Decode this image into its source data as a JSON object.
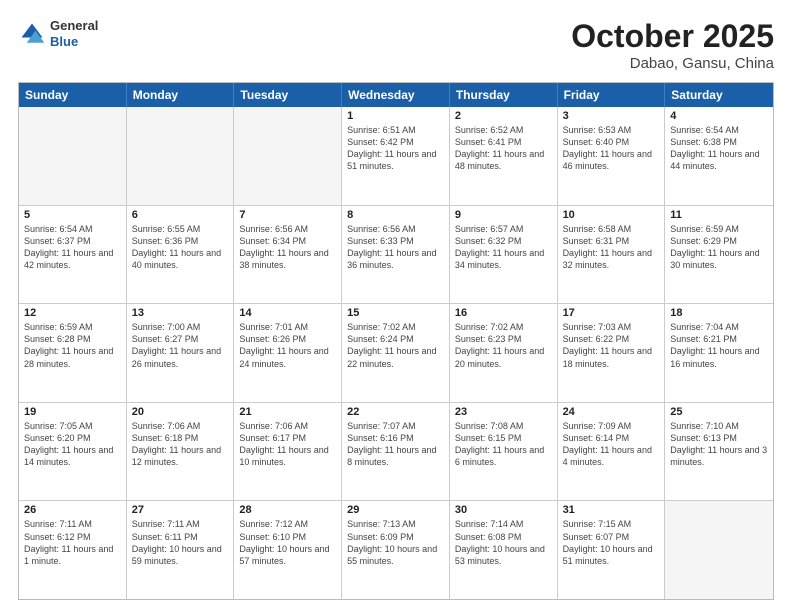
{
  "header": {
    "logo_general": "General",
    "logo_blue": "Blue",
    "title": "October 2025",
    "subtitle": "Dabao, Gansu, China"
  },
  "days": [
    "Sunday",
    "Monday",
    "Tuesday",
    "Wednesday",
    "Thursday",
    "Friday",
    "Saturday"
  ],
  "rows": [
    [
      {
        "date": "",
        "info": "",
        "empty": true
      },
      {
        "date": "",
        "info": "",
        "empty": true
      },
      {
        "date": "",
        "info": "",
        "empty": true
      },
      {
        "date": "1",
        "info": "Sunrise: 6:51 AM\nSunset: 6:42 PM\nDaylight: 11 hours\nand 51 minutes.",
        "empty": false
      },
      {
        "date": "2",
        "info": "Sunrise: 6:52 AM\nSunset: 6:41 PM\nDaylight: 11 hours\nand 48 minutes.",
        "empty": false
      },
      {
        "date": "3",
        "info": "Sunrise: 6:53 AM\nSunset: 6:40 PM\nDaylight: 11 hours\nand 46 minutes.",
        "empty": false
      },
      {
        "date": "4",
        "info": "Sunrise: 6:54 AM\nSunset: 6:38 PM\nDaylight: 11 hours\nand 44 minutes.",
        "empty": false
      }
    ],
    [
      {
        "date": "5",
        "info": "Sunrise: 6:54 AM\nSunset: 6:37 PM\nDaylight: 11 hours\nand 42 minutes.",
        "empty": false
      },
      {
        "date": "6",
        "info": "Sunrise: 6:55 AM\nSunset: 6:36 PM\nDaylight: 11 hours\nand 40 minutes.",
        "empty": false
      },
      {
        "date": "7",
        "info": "Sunrise: 6:56 AM\nSunset: 6:34 PM\nDaylight: 11 hours\nand 38 minutes.",
        "empty": false
      },
      {
        "date": "8",
        "info": "Sunrise: 6:56 AM\nSunset: 6:33 PM\nDaylight: 11 hours\nand 36 minutes.",
        "empty": false
      },
      {
        "date": "9",
        "info": "Sunrise: 6:57 AM\nSunset: 6:32 PM\nDaylight: 11 hours\nand 34 minutes.",
        "empty": false
      },
      {
        "date": "10",
        "info": "Sunrise: 6:58 AM\nSunset: 6:31 PM\nDaylight: 11 hours\nand 32 minutes.",
        "empty": false
      },
      {
        "date": "11",
        "info": "Sunrise: 6:59 AM\nSunset: 6:29 PM\nDaylight: 11 hours\nand 30 minutes.",
        "empty": false
      }
    ],
    [
      {
        "date": "12",
        "info": "Sunrise: 6:59 AM\nSunset: 6:28 PM\nDaylight: 11 hours\nand 28 minutes.",
        "empty": false
      },
      {
        "date": "13",
        "info": "Sunrise: 7:00 AM\nSunset: 6:27 PM\nDaylight: 11 hours\nand 26 minutes.",
        "empty": false
      },
      {
        "date": "14",
        "info": "Sunrise: 7:01 AM\nSunset: 6:26 PM\nDaylight: 11 hours\nand 24 minutes.",
        "empty": false
      },
      {
        "date": "15",
        "info": "Sunrise: 7:02 AM\nSunset: 6:24 PM\nDaylight: 11 hours\nand 22 minutes.",
        "empty": false
      },
      {
        "date": "16",
        "info": "Sunrise: 7:02 AM\nSunset: 6:23 PM\nDaylight: 11 hours\nand 20 minutes.",
        "empty": false
      },
      {
        "date": "17",
        "info": "Sunrise: 7:03 AM\nSunset: 6:22 PM\nDaylight: 11 hours\nand 18 minutes.",
        "empty": false
      },
      {
        "date": "18",
        "info": "Sunrise: 7:04 AM\nSunset: 6:21 PM\nDaylight: 11 hours\nand 16 minutes.",
        "empty": false
      }
    ],
    [
      {
        "date": "19",
        "info": "Sunrise: 7:05 AM\nSunset: 6:20 PM\nDaylight: 11 hours\nand 14 minutes.",
        "empty": false
      },
      {
        "date": "20",
        "info": "Sunrise: 7:06 AM\nSunset: 6:18 PM\nDaylight: 11 hours\nand 12 minutes.",
        "empty": false
      },
      {
        "date": "21",
        "info": "Sunrise: 7:06 AM\nSunset: 6:17 PM\nDaylight: 11 hours\nand 10 minutes.",
        "empty": false
      },
      {
        "date": "22",
        "info": "Sunrise: 7:07 AM\nSunset: 6:16 PM\nDaylight: 11 hours\nand 8 minutes.",
        "empty": false
      },
      {
        "date": "23",
        "info": "Sunrise: 7:08 AM\nSunset: 6:15 PM\nDaylight: 11 hours\nand 6 minutes.",
        "empty": false
      },
      {
        "date": "24",
        "info": "Sunrise: 7:09 AM\nSunset: 6:14 PM\nDaylight: 11 hours\nand 4 minutes.",
        "empty": false
      },
      {
        "date": "25",
        "info": "Sunrise: 7:10 AM\nSunset: 6:13 PM\nDaylight: 11 hours\nand 3 minutes.",
        "empty": false
      }
    ],
    [
      {
        "date": "26",
        "info": "Sunrise: 7:11 AM\nSunset: 6:12 PM\nDaylight: 11 hours\nand 1 minute.",
        "empty": false
      },
      {
        "date": "27",
        "info": "Sunrise: 7:11 AM\nSunset: 6:11 PM\nDaylight: 10 hours\nand 59 minutes.",
        "empty": false
      },
      {
        "date": "28",
        "info": "Sunrise: 7:12 AM\nSunset: 6:10 PM\nDaylight: 10 hours\nand 57 minutes.",
        "empty": false
      },
      {
        "date": "29",
        "info": "Sunrise: 7:13 AM\nSunset: 6:09 PM\nDaylight: 10 hours\nand 55 minutes.",
        "empty": false
      },
      {
        "date": "30",
        "info": "Sunrise: 7:14 AM\nSunset: 6:08 PM\nDaylight: 10 hours\nand 53 minutes.",
        "empty": false
      },
      {
        "date": "31",
        "info": "Sunrise: 7:15 AM\nSunset: 6:07 PM\nDaylight: 10 hours\nand 51 minutes.",
        "empty": false
      },
      {
        "date": "",
        "info": "",
        "empty": true
      }
    ]
  ]
}
